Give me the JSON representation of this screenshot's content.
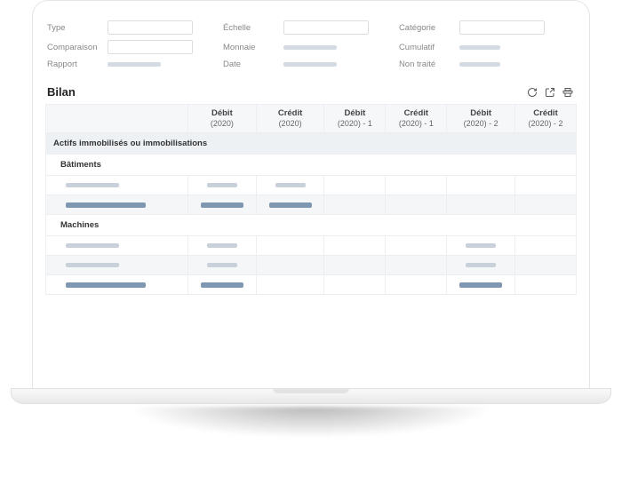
{
  "filters": {
    "type": "Type",
    "echelle": "Échelle",
    "categorie": "Catégorie",
    "comparaison": "Comparaison",
    "monnaie": "Monnaie",
    "cumulatif": "Cumulatif",
    "rapport": "Rapport",
    "date": "Date",
    "non_traite": "Non traité"
  },
  "title": "Bilan",
  "columns": [
    {
      "top": "Débit",
      "sub": "(2020)"
    },
    {
      "top": "Crédit",
      "sub": "(2020)"
    },
    {
      "top": "Débit",
      "sub": "(2020) - 1"
    },
    {
      "top": "Crédit",
      "sub": "(2020) - 1"
    },
    {
      "top": "Débit",
      "sub": "(2020) - 2"
    },
    {
      "top": "Crédit",
      "sub": "(2020) - 2"
    }
  ],
  "section": "Actifs immobilisés ou immobilisations",
  "groups": [
    "Bâtiments",
    "Machines"
  ]
}
